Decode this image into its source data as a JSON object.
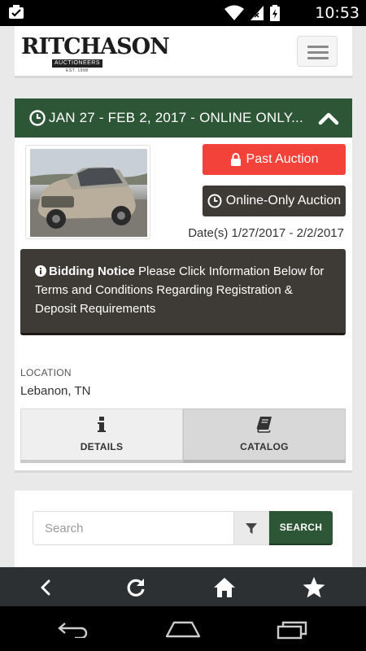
{
  "status_bar": {
    "time": "10:53"
  },
  "header": {
    "logo_name": "RITCHASON",
    "logo_sub": "AUCTIONEERS",
    "logo_est": "EST. 1998"
  },
  "auction": {
    "title": "JAN 27 - FEB 2, 2017 - ONLINE ONLY...",
    "past_label": "Past Auction",
    "online_label": "Online-Only Auction",
    "dates": "Date(s) 1/27/2017 - 2/2/2017",
    "notice_bold": "Bidding Notice",
    "notice_text": " Please Click Information Below for Terms and Conditions Regarding Registration & Deposit Requirements",
    "location_label": "LOCATION",
    "location_value": "Lebanon, TN",
    "tabs": [
      {
        "label": "DETAILS",
        "icon": "info-icon"
      },
      {
        "label": "CATALOG",
        "icon": "book-icon"
      }
    ]
  },
  "search": {
    "placeholder": "Search",
    "button_label": "SEARCH"
  },
  "colors": {
    "brand_green": "#2d5636",
    "past_red": "#f2423a",
    "dark_panel": "#3e3a36"
  }
}
